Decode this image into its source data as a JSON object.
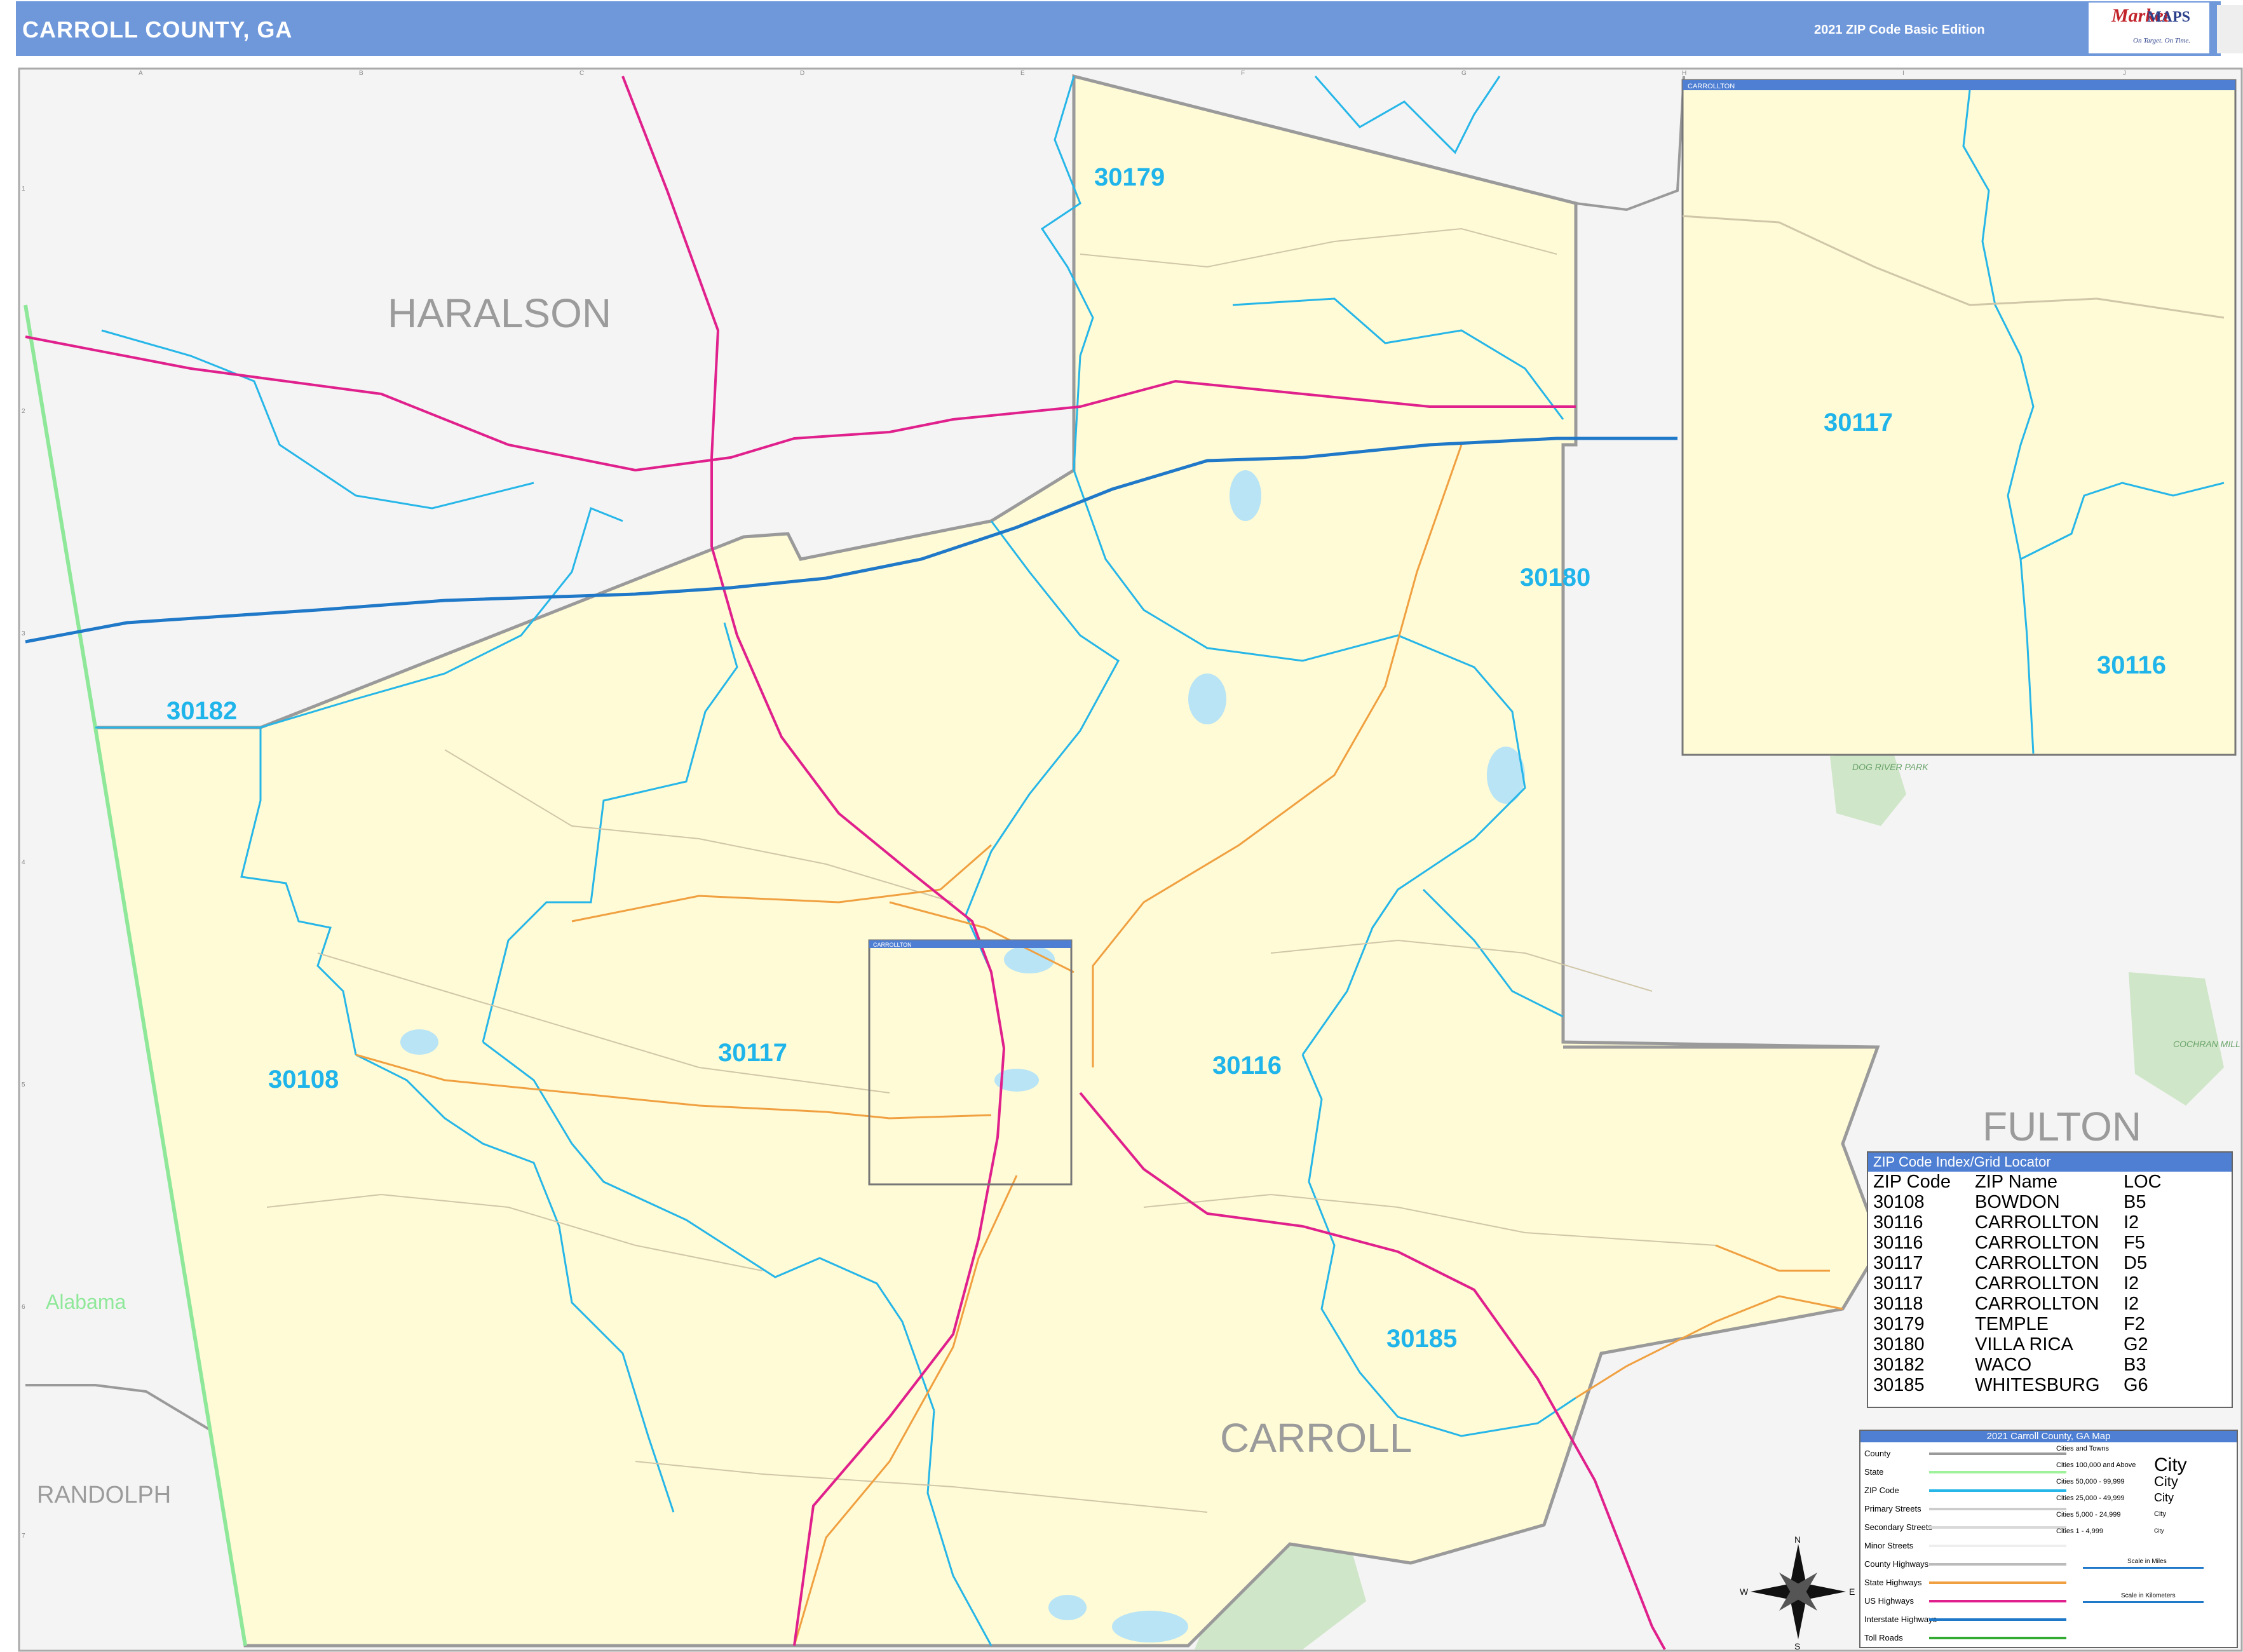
{
  "header": {
    "title": "CARROLL COUNTY, GA",
    "edition": "2021 ZIP Code Basic Edition",
    "brand_market": "Market",
    "brand_maps": "MAPS",
    "brand_tagline": "On Target. On Time."
  },
  "grid": {
    "columns": [
      "A",
      "B",
      "C",
      "D",
      "E",
      "F",
      "G",
      "H",
      "I",
      "J"
    ],
    "rows": [
      "1",
      "2",
      "3",
      "4",
      "5",
      "6",
      "7"
    ]
  },
  "regions": {
    "haralson": "HARALSON",
    "carroll": "CARROLL",
    "fulton": "FULTON",
    "randolph": "RANDOLPH",
    "alabama": "Alabama",
    "dog_river_park": "DOG RIVER PARK",
    "cochran_mill_park": "COCHRAN MILL PARK"
  },
  "zip_labels": [
    {
      "zip": "30179",
      "key": "temple"
    },
    {
      "zip": "30180",
      "key": "villa-rica"
    },
    {
      "zip": "30182",
      "key": "waco"
    },
    {
      "zip": "30108",
      "key": "bowdon"
    },
    {
      "zip": "30117",
      "key": "carrollton-west"
    },
    {
      "zip": "30116",
      "key": "carrollton-east"
    },
    {
      "zip": "30185",
      "key": "whitesburg"
    }
  ],
  "inset": {
    "title": "CARROLLTON",
    "zip_a": "30117",
    "zip_b": "30116"
  },
  "zip_index": {
    "title": "ZIP Code Index/Grid Locator",
    "headers": [
      "ZIP Code",
      "ZIP Name",
      "LOC"
    ],
    "rows": [
      [
        "30108",
        "BOWDON",
        "B5"
      ],
      [
        "30116",
        "CARROLLTON",
        "I2"
      ],
      [
        "30116",
        "CARROLLTON",
        "F5"
      ],
      [
        "30117",
        "CARROLLTON",
        "D5"
      ],
      [
        "30117",
        "CARROLLTON",
        "I2"
      ],
      [
        "30118",
        "CARROLLTON",
        "I2"
      ],
      [
        "30179",
        "TEMPLE",
        "F2"
      ],
      [
        "30180",
        "VILLA RICA",
        "G2"
      ],
      [
        "30182",
        "WACO",
        "B3"
      ],
      [
        "30185",
        "WHITESBURG",
        "G6"
      ]
    ]
  },
  "legend": {
    "title": "2021 Carroll County, GA Map",
    "items": [
      {
        "label": "County",
        "color": "#9a9a9a"
      },
      {
        "label": "State",
        "color": "#9df29a"
      },
      {
        "label": "ZIP Code",
        "color": "#26b6e8"
      },
      {
        "label": "Primary Streets",
        "color": "#cccccc"
      },
      {
        "label": "Secondary Streets",
        "color": "#d9d9d9"
      },
      {
        "label": "Minor Streets",
        "color": "#eeeeee"
      },
      {
        "label": "County Highways",
        "color": "#bbbbbb"
      },
      {
        "label": "State Highways",
        "color": "#f0a040"
      },
      {
        "label": "US Highways",
        "color": "#e0208c"
      },
      {
        "label": "Interstate Highways",
        "color": "#1f78c8"
      },
      {
        "label": "Toll Roads",
        "color": "#33aa33"
      }
    ],
    "cities_header": "Cities and Towns",
    "cities": [
      {
        "label": "Cities 100,000 and Above",
        "glyph": "City"
      },
      {
        "label": "Cities 50,000 - 99,999",
        "glyph": "City"
      },
      {
        "label": "Cities 25,000 - 49,999",
        "glyph": "City"
      },
      {
        "label": "Cities 5,000 - 24,999",
        "glyph": "City"
      },
      {
        "label": "Cities 1 - 4,999",
        "glyph": "City"
      }
    ],
    "scale_miles": "Scale in Miles",
    "scale_km": "Scale in Kilometers"
  },
  "compass": {
    "n": "N",
    "s": "S",
    "e": "E",
    "w": "W"
  },
  "colors": {
    "header": "#6f98db",
    "county_fill": "#fffbd6",
    "outside_fill": "#f4f4f4",
    "zip_boundary": "#26b6e8",
    "zip_label": "#1fb4ea",
    "interstate": "#1f78c8",
    "us_highway": "#e0208c",
    "state_highway": "#f0a040",
    "park": "#cfe6c8",
    "water": "#b8e4f5"
  }
}
